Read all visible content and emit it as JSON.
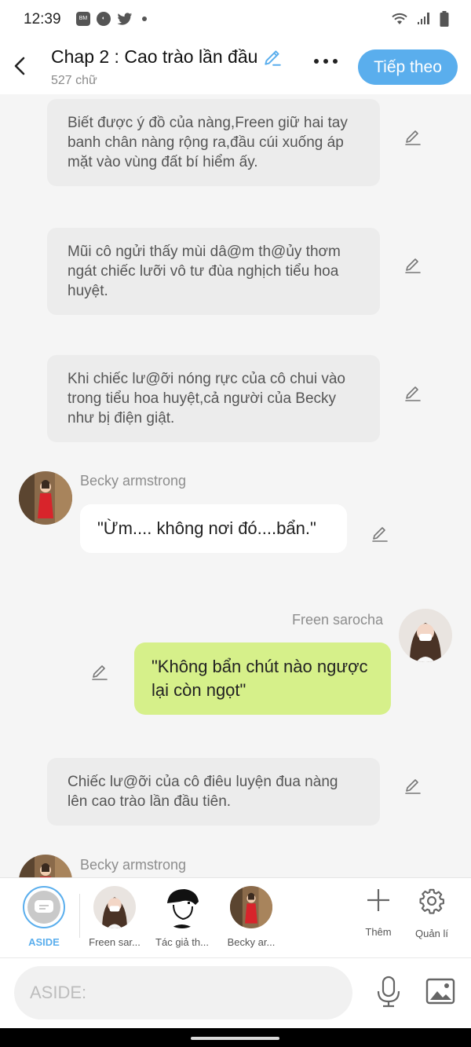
{
  "status": {
    "time": "12:39",
    "left_icons": [
      "bao-moi-icon",
      "compass-icon",
      "twitter-icon",
      "dot-icon"
    ],
    "right_icons": [
      "wifi-icon",
      "signal-icon",
      "battery-icon"
    ]
  },
  "header": {
    "title": "Chap 2 : Cao trào lần đầu",
    "word_count": "527 chữ",
    "next_label": "Tiếp theo"
  },
  "messages": {
    "narration_1": "Biết được ý đồ của nàng,Freen giữ hai tay banh chân nàng rộng ra,đầu cúi xuống áp mặt vào vùng đất bí hiểm ấy.",
    "narration_2": "Mũi cô ngửi thấy mùi dâ@m th@ủy thơm ngát chiếc lưỡi vô tư đùa nghịch tiểu hoa huyệt.",
    "narration_3": "Khi chiếc lư@ỡi nóng rực của cô chui vào trong tiểu hoa huyệt,cả người của Becky như bị điện giật.",
    "becky_name": "Becky armstrong",
    "becky_text": "\"Ừm.... không nơi đó....bẩn.\"",
    "freen_name": "Freen sarocha",
    "freen_text": "\"Không bẩn chút nào ngược lại còn ngọt\"",
    "narration_4": "Chiếc lư@ỡi của cô điêu luyện đua nàng lên cao trào lần đầu tiên.",
    "becky_name_2": "Becky armstrong"
  },
  "characters": [
    {
      "label": "ASIDE"
    },
    {
      "label": "Freen sar..."
    },
    {
      "label": "Tác giả th..."
    },
    {
      "label": "Becky ar..."
    }
  ],
  "tools": {
    "add_label": "Thêm",
    "manage_label": "Quản lí"
  },
  "input": {
    "placeholder": "ASIDE:"
  },
  "colors": {
    "accent": "#5aaeed",
    "bubble_right": "#d6f08a",
    "narration_bg": "#ececec"
  }
}
